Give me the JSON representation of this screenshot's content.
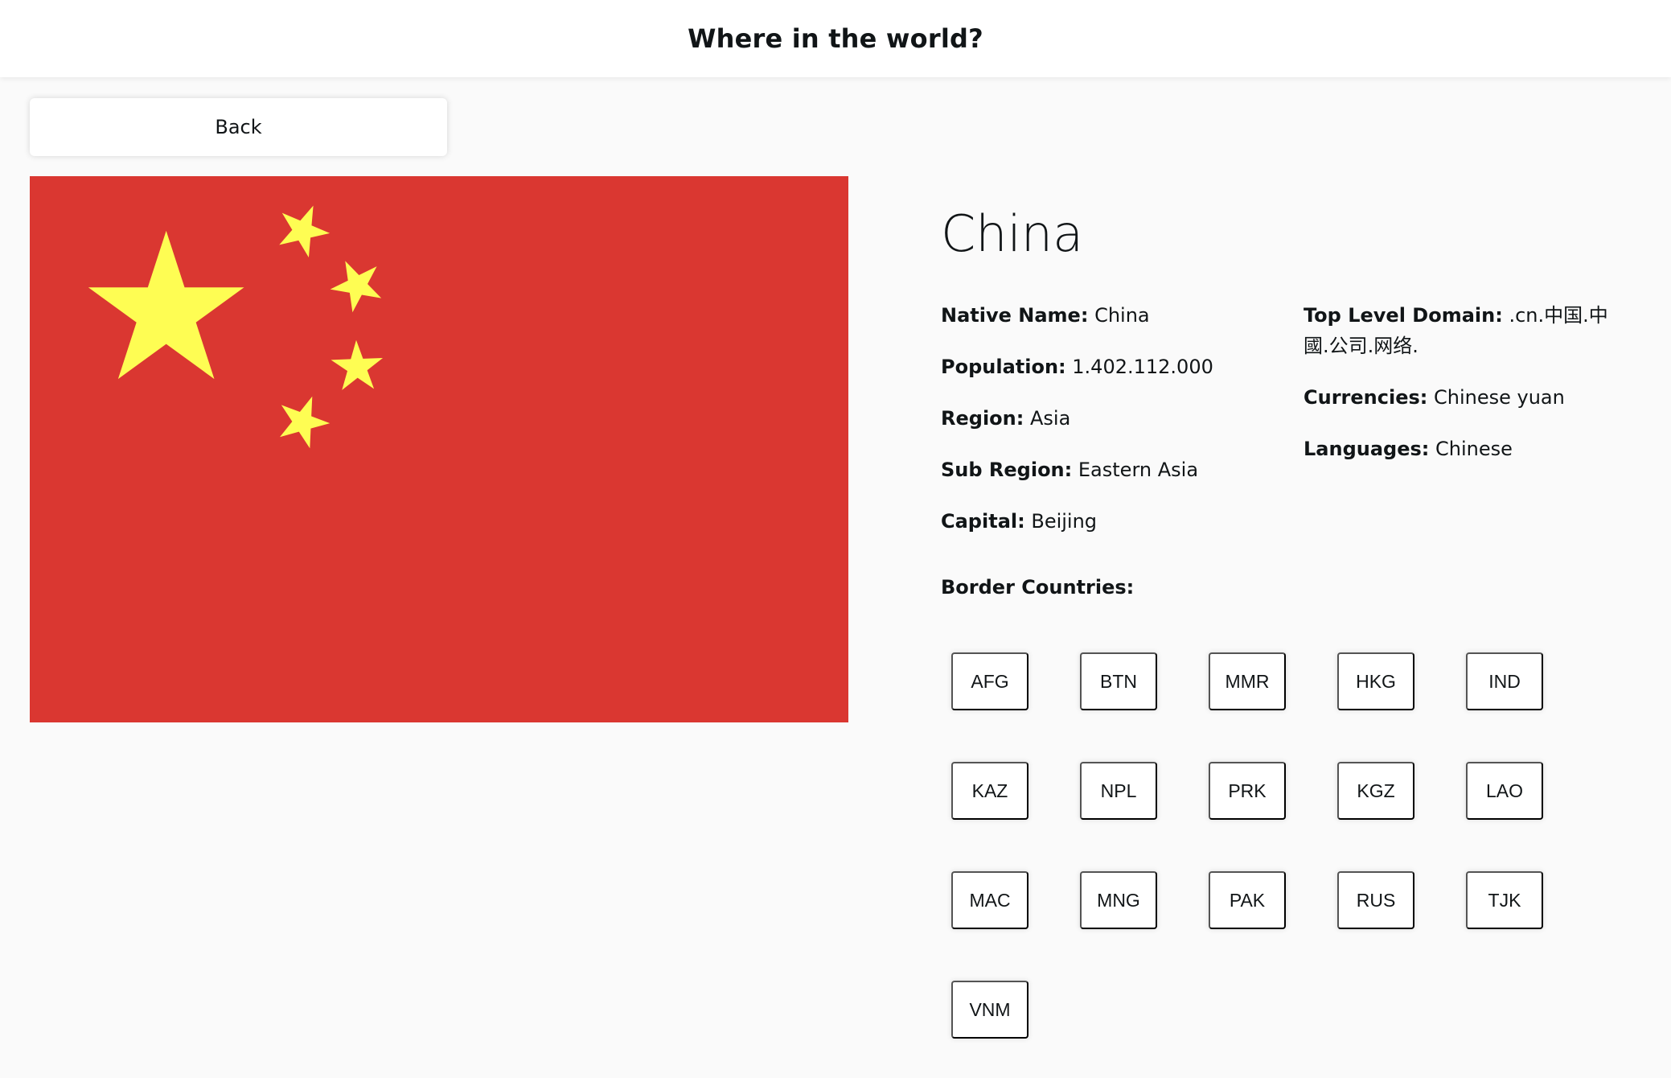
{
  "header": {
    "title": "Where in the world?"
  },
  "back_button": {
    "label": "Back"
  },
  "country": {
    "name": "China",
    "flag": {
      "background": "#da3731",
      "star_color": "#fefd53"
    },
    "native_name": {
      "label": "Native Name:",
      "value": "China"
    },
    "population": {
      "label": "Population:",
      "value": "1.402.112.000"
    },
    "region": {
      "label": "Region:",
      "value": "Asia"
    },
    "sub_region": {
      "label": "Sub Region:",
      "value": "Eastern Asia"
    },
    "capital": {
      "label": "Capital:",
      "value": "Beijing"
    },
    "top_level_domain": {
      "label": "Top Level Domain:",
      "value": ".cn.中国.中國.公司.网络."
    },
    "currencies": {
      "label": "Currencies:",
      "value": "Chinese yuan"
    },
    "languages": {
      "label": "Languages:",
      "value": "Chinese"
    },
    "border_countries_label": "Border Countries:",
    "border_countries": [
      "AFG",
      "BTN",
      "MMR",
      "HKG",
      "IND",
      "KAZ",
      "NPL",
      "PRK",
      "KGZ",
      "LAO",
      "MAC",
      "MNG",
      "PAK",
      "RUS",
      "TJK",
      "VNM"
    ]
  }
}
